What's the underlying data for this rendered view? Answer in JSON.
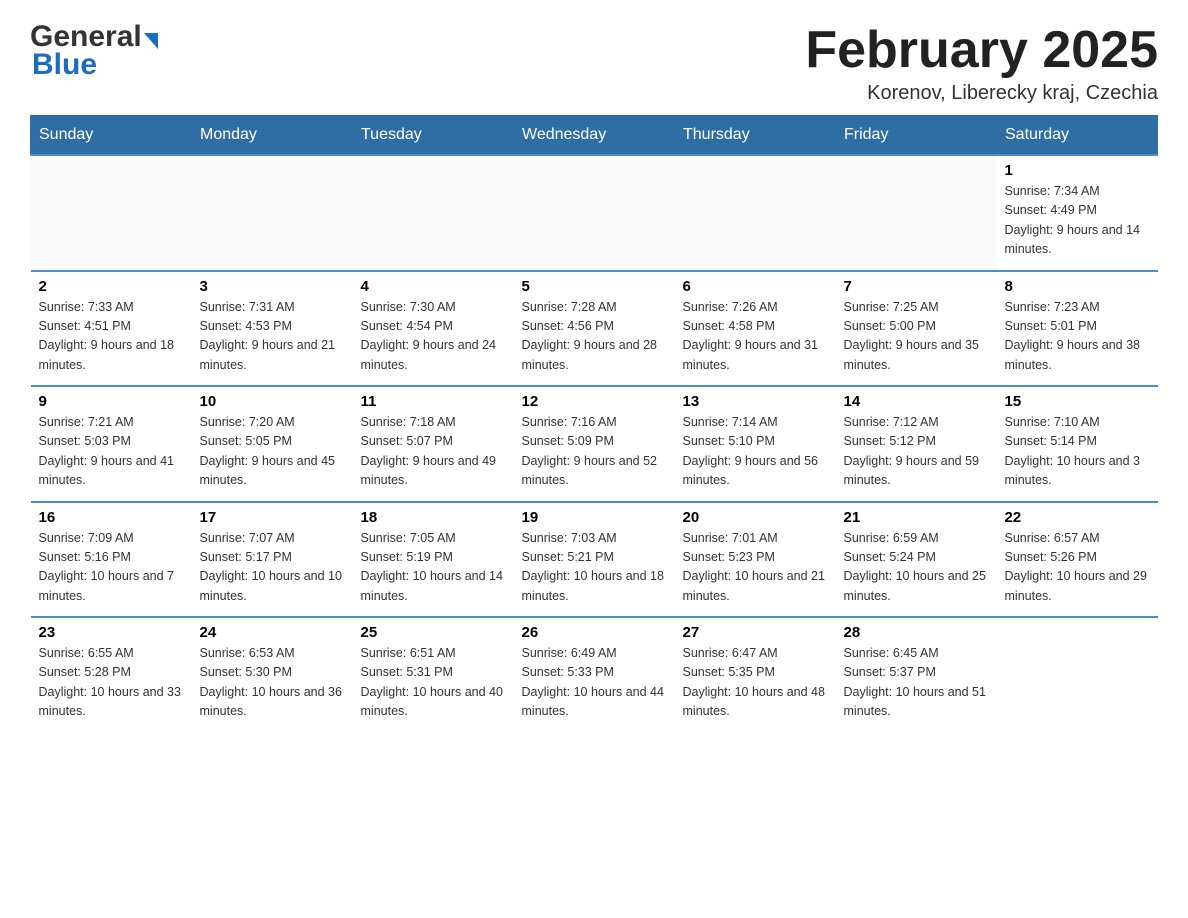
{
  "header": {
    "logo_line1": "General",
    "logo_line2": "Blue",
    "month_title": "February 2025",
    "location": "Korenov, Liberecky kraj, Czechia"
  },
  "weekdays": [
    "Sunday",
    "Monday",
    "Tuesday",
    "Wednesday",
    "Thursday",
    "Friday",
    "Saturday"
  ],
  "weeks": [
    [
      {
        "day": "",
        "info": ""
      },
      {
        "day": "",
        "info": ""
      },
      {
        "day": "",
        "info": ""
      },
      {
        "day": "",
        "info": ""
      },
      {
        "day": "",
        "info": ""
      },
      {
        "day": "",
        "info": ""
      },
      {
        "day": "1",
        "info": "Sunrise: 7:34 AM\nSunset: 4:49 PM\nDaylight: 9 hours and 14 minutes."
      }
    ],
    [
      {
        "day": "2",
        "info": "Sunrise: 7:33 AM\nSunset: 4:51 PM\nDaylight: 9 hours and 18 minutes."
      },
      {
        "day": "3",
        "info": "Sunrise: 7:31 AM\nSunset: 4:53 PM\nDaylight: 9 hours and 21 minutes."
      },
      {
        "day": "4",
        "info": "Sunrise: 7:30 AM\nSunset: 4:54 PM\nDaylight: 9 hours and 24 minutes."
      },
      {
        "day": "5",
        "info": "Sunrise: 7:28 AM\nSunset: 4:56 PM\nDaylight: 9 hours and 28 minutes."
      },
      {
        "day": "6",
        "info": "Sunrise: 7:26 AM\nSunset: 4:58 PM\nDaylight: 9 hours and 31 minutes."
      },
      {
        "day": "7",
        "info": "Sunrise: 7:25 AM\nSunset: 5:00 PM\nDaylight: 9 hours and 35 minutes."
      },
      {
        "day": "8",
        "info": "Sunrise: 7:23 AM\nSunset: 5:01 PM\nDaylight: 9 hours and 38 minutes."
      }
    ],
    [
      {
        "day": "9",
        "info": "Sunrise: 7:21 AM\nSunset: 5:03 PM\nDaylight: 9 hours and 41 minutes."
      },
      {
        "day": "10",
        "info": "Sunrise: 7:20 AM\nSunset: 5:05 PM\nDaylight: 9 hours and 45 minutes."
      },
      {
        "day": "11",
        "info": "Sunrise: 7:18 AM\nSunset: 5:07 PM\nDaylight: 9 hours and 49 minutes."
      },
      {
        "day": "12",
        "info": "Sunrise: 7:16 AM\nSunset: 5:09 PM\nDaylight: 9 hours and 52 minutes."
      },
      {
        "day": "13",
        "info": "Sunrise: 7:14 AM\nSunset: 5:10 PM\nDaylight: 9 hours and 56 minutes."
      },
      {
        "day": "14",
        "info": "Sunrise: 7:12 AM\nSunset: 5:12 PM\nDaylight: 9 hours and 59 minutes."
      },
      {
        "day": "15",
        "info": "Sunrise: 7:10 AM\nSunset: 5:14 PM\nDaylight: 10 hours and 3 minutes."
      }
    ],
    [
      {
        "day": "16",
        "info": "Sunrise: 7:09 AM\nSunset: 5:16 PM\nDaylight: 10 hours and 7 minutes."
      },
      {
        "day": "17",
        "info": "Sunrise: 7:07 AM\nSunset: 5:17 PM\nDaylight: 10 hours and 10 minutes."
      },
      {
        "day": "18",
        "info": "Sunrise: 7:05 AM\nSunset: 5:19 PM\nDaylight: 10 hours and 14 minutes."
      },
      {
        "day": "19",
        "info": "Sunrise: 7:03 AM\nSunset: 5:21 PM\nDaylight: 10 hours and 18 minutes."
      },
      {
        "day": "20",
        "info": "Sunrise: 7:01 AM\nSunset: 5:23 PM\nDaylight: 10 hours and 21 minutes."
      },
      {
        "day": "21",
        "info": "Sunrise: 6:59 AM\nSunset: 5:24 PM\nDaylight: 10 hours and 25 minutes."
      },
      {
        "day": "22",
        "info": "Sunrise: 6:57 AM\nSunset: 5:26 PM\nDaylight: 10 hours and 29 minutes."
      }
    ],
    [
      {
        "day": "23",
        "info": "Sunrise: 6:55 AM\nSunset: 5:28 PM\nDaylight: 10 hours and 33 minutes."
      },
      {
        "day": "24",
        "info": "Sunrise: 6:53 AM\nSunset: 5:30 PM\nDaylight: 10 hours and 36 minutes."
      },
      {
        "day": "25",
        "info": "Sunrise: 6:51 AM\nSunset: 5:31 PM\nDaylight: 10 hours and 40 minutes."
      },
      {
        "day": "26",
        "info": "Sunrise: 6:49 AM\nSunset: 5:33 PM\nDaylight: 10 hours and 44 minutes."
      },
      {
        "day": "27",
        "info": "Sunrise: 6:47 AM\nSunset: 5:35 PM\nDaylight: 10 hours and 48 minutes."
      },
      {
        "day": "28",
        "info": "Sunrise: 6:45 AM\nSunset: 5:37 PM\nDaylight: 10 hours and 51 minutes."
      },
      {
        "day": "",
        "info": ""
      }
    ]
  ],
  "colors": {
    "header_bg": "#2f6ea5",
    "header_text": "#ffffff",
    "border_top": "#4a90c4",
    "text_dark": "#222222",
    "text_body": "#333333"
  }
}
